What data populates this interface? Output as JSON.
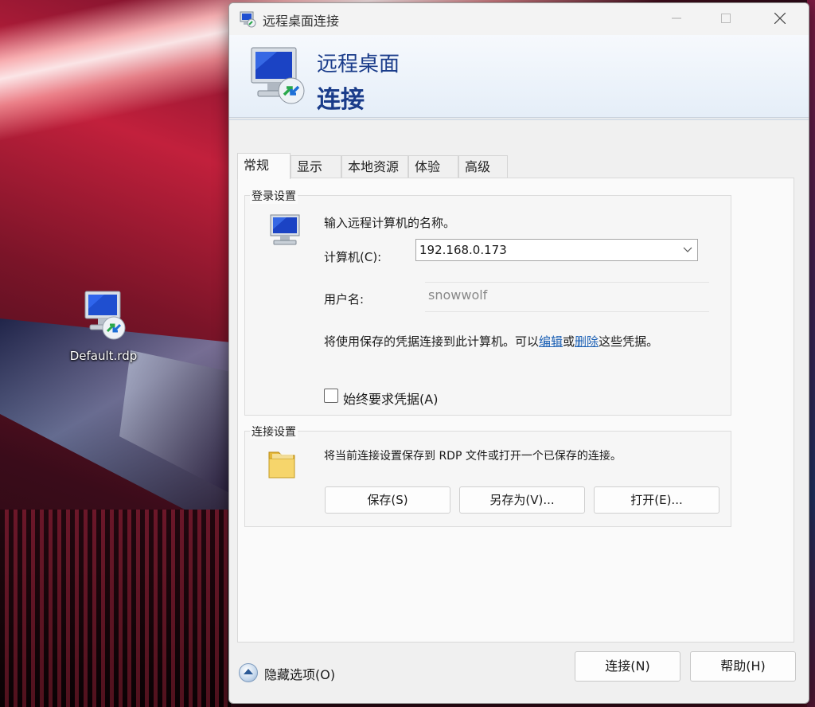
{
  "desktop": {
    "icon_label": "Default.rdp"
  },
  "window": {
    "title": "远程桌面连接",
    "banner_line1": "远程桌面",
    "banner_line2": "连接"
  },
  "tabs": [
    {
      "label": "常规",
      "active": true
    },
    {
      "label": "显示",
      "active": false
    },
    {
      "label": "本地资源",
      "active": false
    },
    {
      "label": "体验",
      "active": false
    },
    {
      "label": "高级",
      "active": false
    }
  ],
  "login": {
    "group_title": "登录设置",
    "instruction": "输入远程计算机的名称。",
    "computer_label": "计算机(C):",
    "computer_value": "192.168.0.173",
    "username_label": "用户名:",
    "username_value": "snowwolf",
    "cred_text_before": "将使用保存的凭据连接到此计算机。可以",
    "edit_link": "编辑",
    "or_text": "或",
    "delete_link": "删除",
    "cred_text_after": "这些凭据。",
    "always_ask_label": "始终要求凭据(A)",
    "always_ask_checked": false
  },
  "connection": {
    "group_title": "连接设置",
    "description": "将当前连接设置保存到 RDP 文件或打开一个已保存的连接。",
    "save_label": "保存(S)",
    "save_as_label": "另存为(V)...",
    "open_label": "打开(E)..."
  },
  "footer": {
    "hide_options_label": "隐藏选项(O)",
    "connect_label": "连接(N)",
    "help_label": "帮助(H)"
  },
  "icons": {
    "app": "remote-desktop-icon",
    "computer": "monitor-icon",
    "folder": "folder-icon",
    "minimize": "minimize-icon",
    "maximize": "maximize-icon",
    "close": "close-icon",
    "hide_options": "chevron-up-icon"
  },
  "colors": {
    "banner_text": "#1a3c8a",
    "link": "#1a5fb4"
  }
}
